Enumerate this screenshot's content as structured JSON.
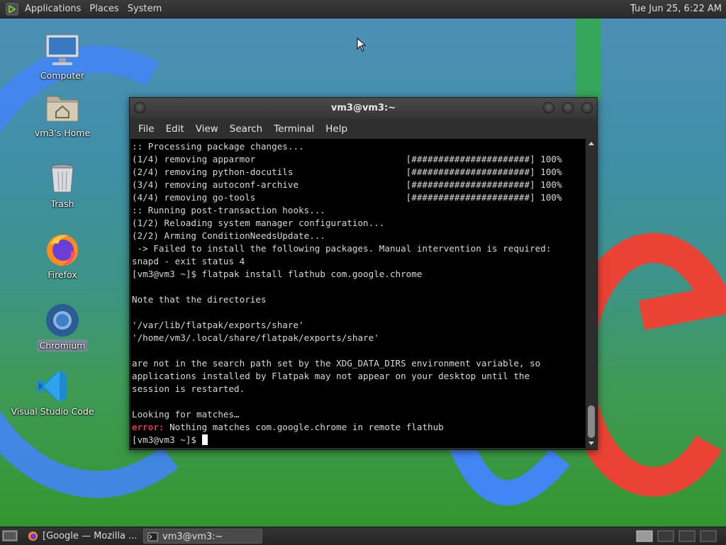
{
  "top_panel": {
    "menus": [
      "Applications",
      "Places",
      "System"
    ],
    "clock": "Tue Jun 25,  6:22 AM"
  },
  "desktop": {
    "icons": [
      {
        "label": "Computer",
        "icon": "computer-icon"
      },
      {
        "label": "vm3's Home",
        "icon": "home-folder-icon"
      },
      {
        "label": "Trash",
        "icon": "trash-icon"
      },
      {
        "label": "Firefox",
        "icon": "firefox-icon"
      },
      {
        "label": "Chromium",
        "icon": "chromium-icon",
        "selected": true
      },
      {
        "label": "Visual Studio Code",
        "icon": "vscode-icon"
      }
    ]
  },
  "terminal": {
    "title": "vm3@vm3:~",
    "menu": [
      "File",
      "Edit",
      "View",
      "Search",
      "Terminal",
      "Help"
    ],
    "lines": [
      ":: Processing package changes...",
      "(1/4) removing apparmor                            [######################] 100%",
      "(2/4) removing python-docutils                     [######################] 100%",
      "(3/4) removing autoconf-archive                    [######################] 100%",
      "(4/4) removing go-tools                            [######################] 100%",
      ":: Running post-transaction hooks...",
      "(1/2) Reloading system manager configuration...",
      "(2/2) Arming ConditionNeedsUpdate...",
      " -> Failed to install the following packages. Manual intervention is required:",
      "snapd - exit status 4",
      "[vm3@vm3 ~]$ flatpak install flathub com.google.chrome",
      "",
      "Note that the directories",
      "",
      "'/var/lib/flatpak/exports/share'",
      "'/home/vm3/.local/share/flatpak/exports/share'",
      "",
      "are not in the search path set by the XDG_DATA_DIRS environment variable, so",
      "applications installed by Flatpak may not appear on your desktop until the",
      "session is restarted.",
      "",
      "Looking for matches…"
    ],
    "error_label": "error:",
    "error_text": " Nothing matches com.google.chrome in remote flathub",
    "prompt": "[vm3@vm3 ~]$ "
  },
  "taskbar": {
    "tasks": [
      {
        "label": "[Google — Mozilla ...",
        "icon": "firefox-icon",
        "active": false
      },
      {
        "label": "vm3@vm3:~",
        "icon": "terminal-icon",
        "active": true
      }
    ]
  },
  "colors": {
    "error": "#e8314a",
    "google_blue": "#4285f4",
    "google_red": "#ea4335",
    "google_green": "#34a853"
  }
}
